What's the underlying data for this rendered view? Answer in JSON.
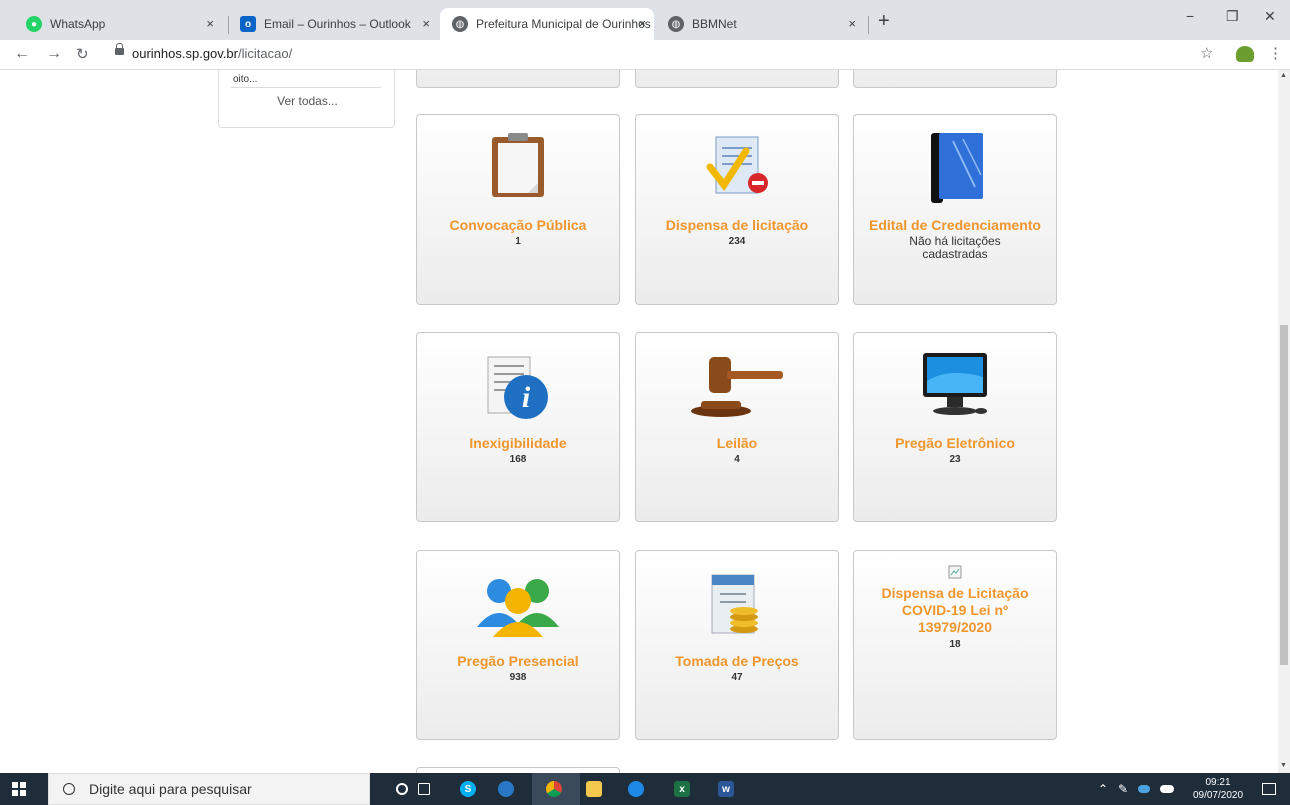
{
  "browser": {
    "tabs": [
      {
        "label": "WhatsApp",
        "icon": "whatsapp-icon",
        "close": "×"
      },
      {
        "label": "Email – Ourinhos – Outlook",
        "icon": "outlook-icon",
        "close": "×"
      },
      {
        "label": "Prefeitura Municipal de Ourinhos",
        "icon": "globe-icon",
        "close": "×",
        "active": true
      },
      {
        "label": "BBMNet",
        "icon": "globe-icon",
        "close": "×"
      }
    ],
    "new_tab": "+",
    "url_host": "ourinhos.sp.gov.br",
    "url_path": "/licitacao/"
  },
  "sidebar": {
    "truncated_text": "oito...",
    "see_all": "Ver todas..."
  },
  "categories": [
    {
      "title": "Convocação Pública",
      "count": "1",
      "icon": "clipboard-icon"
    },
    {
      "title": "Dispensa de licitação",
      "count": "234",
      "icon": "document-check-icon"
    },
    {
      "title": "Edital de Credenciamento",
      "note_line1": "Não há licitações",
      "note_line2": "cadastradas",
      "icon": "blue-book-icon"
    },
    {
      "title": "Inexigibilidade",
      "count": "168",
      "icon": "info-document-icon"
    },
    {
      "title": "Leilão",
      "count": "4",
      "icon": "gavel-icon"
    },
    {
      "title": "Pregão Eletrônico",
      "count": "23",
      "icon": "computer-monitor-icon"
    },
    {
      "title": "Pregão Presencial",
      "count": "938",
      "icon": "people-icon"
    },
    {
      "title": "Tomada de Preços",
      "count": "47",
      "icon": "calculator-coins-icon"
    },
    {
      "title_line1": "Dispensa de Licitação",
      "title_line2": "COVID-19 Lei nº",
      "title_line3": "13979/2020",
      "count": "18",
      "icon": "broken-image-icon"
    }
  ],
  "taskbar": {
    "search_placeholder": "Digite aqui para pesquisar",
    "time": "09:21",
    "date": "09/07/2020"
  },
  "colors": {
    "accent_orange": "#f0962d",
    "taskbar": "#1f2c3a",
    "tabbar": "#dee1e6"
  }
}
